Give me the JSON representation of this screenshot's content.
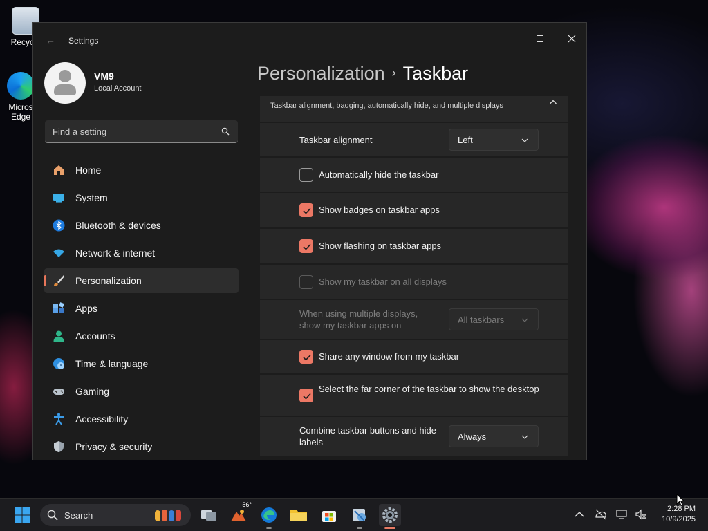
{
  "desktop": {
    "icons": [
      {
        "label": "Recycle"
      },
      {
        "label": "Micros Edge"
      }
    ]
  },
  "window": {
    "title": "Settings",
    "controls": {
      "minimize": "minimize",
      "maximize": "maximize",
      "close": "close"
    }
  },
  "profile": {
    "name": "VM9",
    "account_type": "Local Account"
  },
  "search": {
    "placeholder": "Find a setting"
  },
  "sidebar": {
    "items": [
      {
        "label": "Home",
        "icon": "home-icon"
      },
      {
        "label": "System",
        "icon": "monitor-icon"
      },
      {
        "label": "Bluetooth & devices",
        "icon": "bluetooth-icon"
      },
      {
        "label": "Network & internet",
        "icon": "wifi-icon"
      },
      {
        "label": "Personalization",
        "icon": "brush-icon",
        "active": true
      },
      {
        "label": "Apps",
        "icon": "apps-icon"
      },
      {
        "label": "Accounts",
        "icon": "person-icon"
      },
      {
        "label": "Time & language",
        "icon": "globe-clock-icon"
      },
      {
        "label": "Gaming",
        "icon": "gamepad-icon"
      },
      {
        "label": "Accessibility",
        "icon": "accessibility-icon"
      },
      {
        "label": "Privacy & security",
        "icon": "shield-icon"
      }
    ]
  },
  "breadcrumb": {
    "parent": "Personalization",
    "separator": "›",
    "current": "Taskbar"
  },
  "section": {
    "description": "Taskbar alignment, badging, automatically hide, and multiple displays"
  },
  "settings": {
    "alignment": {
      "label": "Taskbar alignment",
      "value": "Left"
    },
    "auto_hide": {
      "label": "Automatically hide the taskbar",
      "checked": false
    },
    "badges": {
      "label": "Show badges on taskbar apps",
      "checked": true
    },
    "flashing": {
      "label": "Show flashing on taskbar apps",
      "checked": true
    },
    "all_displays": {
      "label": "Show my taskbar on all displays",
      "checked": false,
      "disabled": true
    },
    "multi_display": {
      "label": "When using multiple displays, show my taskbar apps on",
      "value": "All taskbars",
      "disabled": true
    },
    "share_window": {
      "label": "Share any window from my taskbar",
      "checked": true
    },
    "far_corner": {
      "label": "Select the far corner of the taskbar to show the desktop",
      "checked": true
    },
    "combine": {
      "label": "Combine taskbar buttons and hide labels",
      "value": "Always"
    }
  },
  "taskbar": {
    "search_label": "Search",
    "weather_temp": "56°",
    "apps": [
      "start-icon",
      "search",
      "task-view-icon",
      "weather-icon",
      "edge-icon",
      "file-explorer-icon",
      "store-icon",
      "snipping-tool-icon",
      "settings-icon"
    ],
    "clock": {
      "time": "2:28 PM",
      "date": "10/9/2025"
    }
  },
  "colors": {
    "accent": "#ec7865",
    "window_bg": "#1c1c1c",
    "card_bg": "#272727"
  }
}
